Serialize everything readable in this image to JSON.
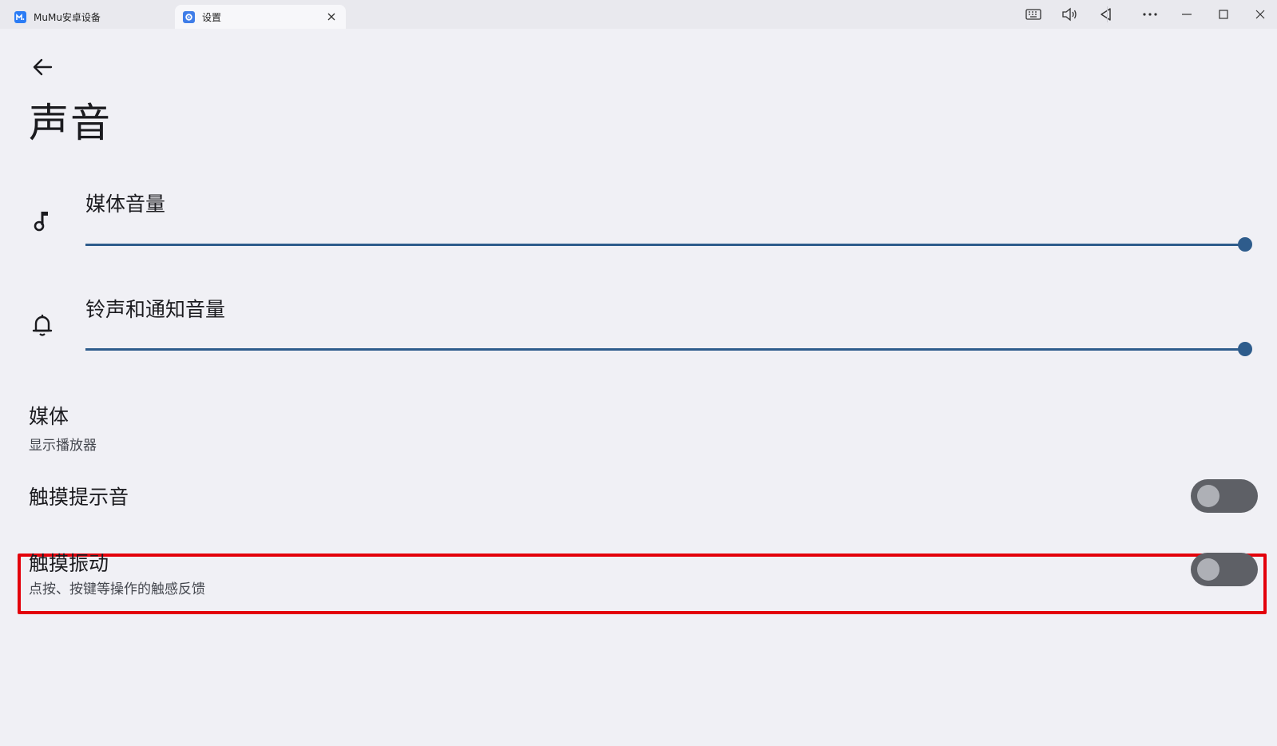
{
  "window": {
    "tabs": [
      {
        "label": "MuMu安卓设备",
        "active": false
      },
      {
        "label": "设置",
        "active": true
      }
    ],
    "toolbar": [
      "keyboard-icon",
      "volume-icon",
      "back-triangle-icon",
      "more-icon",
      "minimize-icon",
      "maximize-icon",
      "close-icon"
    ]
  },
  "page": {
    "title": "声音"
  },
  "volumes": [
    {
      "label": "媒体音量",
      "icon": "music-note-icon",
      "level": 1.0
    },
    {
      "label": "铃声和通知音量",
      "icon": "bell-icon",
      "level": 1.0
    }
  ],
  "settings": {
    "media": {
      "title": "媒体",
      "subtitle": "显示播放器"
    },
    "touch_sound": {
      "title": "触摸提示音",
      "enabled": false
    },
    "touch_vibration": {
      "title": "触摸振动",
      "subtitle": "点按、按键等操作的触感反馈",
      "enabled": false
    }
  },
  "colors": {
    "accent": "#2e5c8c",
    "highlight": "#e3000b",
    "background": "#f0f0f5"
  }
}
